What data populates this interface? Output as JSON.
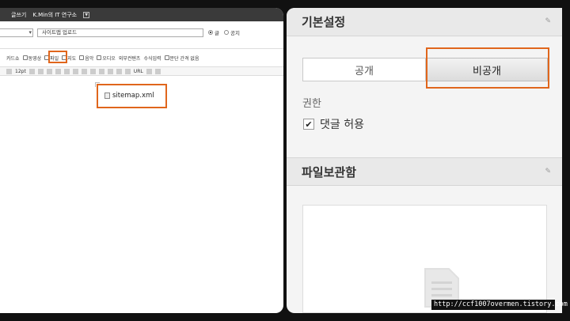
{
  "editor": {
    "topbar": {
      "tab": "글쓰기",
      "blog_name": "K.Min의 IT 연구소"
    },
    "title_row": {
      "title_value": "사이트맵 업로드",
      "radio_post": "글",
      "radio_notice": "공지"
    },
    "toolbar1": [
      "카드쇼",
      "동영상",
      "파일",
      "지도",
      "음악",
      "오디오",
      "외부컨텐츠",
      "수식입력",
      "문단 간격 없음"
    ],
    "toolbar2": {
      "size": "12pt",
      "link": "URL"
    },
    "attachment": {
      "filename": "sitemap.xml"
    }
  },
  "settings": {
    "basic": {
      "title": "기본설정",
      "visibility_tabs": [
        "공개",
        "비공개"
      ],
      "selected_tab": "비공개",
      "permission_label": "권한",
      "allow_comments": {
        "label": "댓글 허용",
        "checked": true
      }
    },
    "file_storage": {
      "title": "파일보관함"
    }
  },
  "watermark": "http://ccf1007overmen.tistory.com",
  "colors": {
    "highlight": "#e0661c",
    "dark_bg": "#111111"
  }
}
